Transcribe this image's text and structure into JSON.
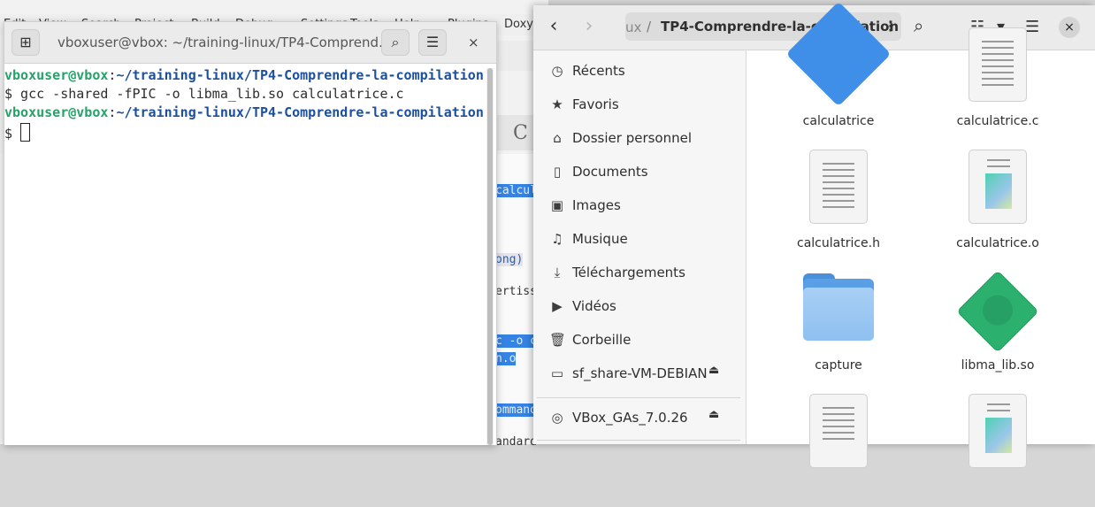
{
  "background_app": {
    "menu": [
      "Edit",
      "View",
      "Search",
      "Project",
      "Build",
      "Debug",
      "Settings",
      "Tools",
      "Help",
      "Plugins",
      "Doxy"
    ],
    "letter": "C",
    "code_lines": [
      {
        "text": "calcul",
        "style": "highlight"
      },
      {
        "text": "ong)",
        "style": "blue"
      },
      {
        "text": "ertiss",
        "style": "plain"
      },
      {
        "text": "c -o c",
        "style": "highlight"
      },
      {
        "text": "n.o",
        "style": "highlight"
      },
      {
        "text": "ommand",
        "style": "highlight"
      },
      {
        "text": "andard",
        "style": "plain"
      }
    ]
  },
  "terminal": {
    "title": "vboxuser@vbox: ~/training-linux/TP4-Comprend…",
    "new_tab_icon": "new-tab-icon",
    "search_icon": "search-icon",
    "menu_icon": "hamburger-menu-icon",
    "close_glyph": "×",
    "lines": [
      {
        "user": "vboxuser@vbox",
        "sep": ":",
        "path": "~/training-linux/TP4-Comprendre-la-compilation",
        "command": ""
      },
      {
        "text": "$ gcc -shared -fPIC -o libma_lib.so calculatrice.c"
      },
      {
        "user": "vboxuser@vbox",
        "sep": ":",
        "path": "~/training-linux/TP4-Comprendre-la-compilation",
        "command": ""
      },
      {
        "text": "$ "
      }
    ]
  },
  "file_manager": {
    "back_glyph": "‹",
    "forward_glyph": "›",
    "path_prev": "ux",
    "path_sep": "/",
    "path_current": "TP4-Comprendre-la-compilation",
    "path_menu_glyph": "⋮",
    "search_glyph": "⌕",
    "view_glyph": "☷",
    "view_dropdown_glyph": "▾",
    "menu_glyph": "☰",
    "close_glyph": "×",
    "sidebar": [
      {
        "label": "Récents",
        "icon": "clock-icon",
        "glyph": "◷"
      },
      {
        "label": "Favoris",
        "icon": "star-icon",
        "glyph": "★"
      },
      {
        "label": "Dossier personnel",
        "icon": "home-icon",
        "glyph": "⌂"
      },
      {
        "label": "Documents",
        "icon": "document-icon",
        "glyph": "▯"
      },
      {
        "label": "Images",
        "icon": "image-icon",
        "glyph": "▣"
      },
      {
        "label": "Musique",
        "icon": "music-icon",
        "glyph": "♫"
      },
      {
        "label": "Téléchargements",
        "icon": "download-icon",
        "glyph": "⤓"
      },
      {
        "label": "Vidéos",
        "icon": "video-icon",
        "glyph": "▶"
      },
      {
        "label": "Corbeille",
        "icon": "trash-icon",
        "glyph": "🗑"
      },
      {
        "label": "sf_share-VM-DEBIAN",
        "icon": "drive-icon",
        "glyph": "▭",
        "eject": "⏏"
      },
      {
        "label": "VBox_GAs_7.0.26",
        "icon": "disc-icon",
        "glyph": "◎",
        "eject": "⏏"
      }
    ],
    "files": [
      {
        "name": "calculatrice",
        "type": "executable"
      },
      {
        "name": "calculatrice.c",
        "type": "text"
      },
      {
        "name": "calculatrice.h",
        "type": "text"
      },
      {
        "name": "calculatrice.o",
        "type": "object"
      },
      {
        "name": "capture",
        "type": "folder"
      },
      {
        "name": "libma_lib.so",
        "type": "library"
      },
      {
        "name": "",
        "type": "text"
      },
      {
        "name": "",
        "type": "object"
      }
    ]
  }
}
